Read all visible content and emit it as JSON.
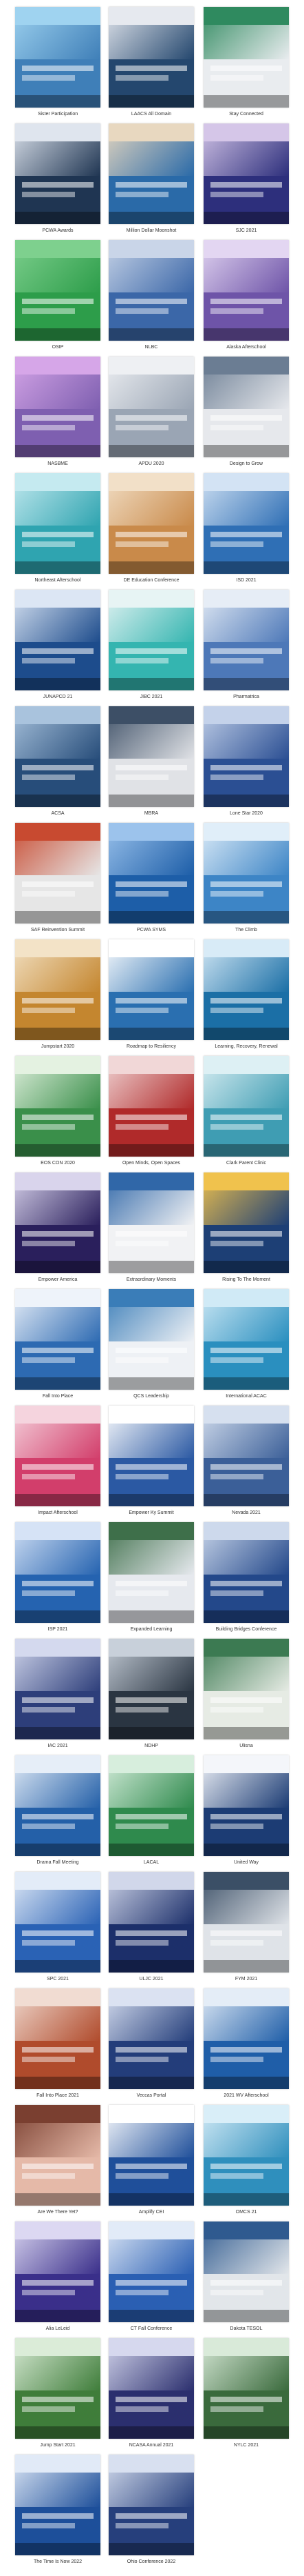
{
  "gallery": {
    "items": [
      {
        "label": "Sister Participation",
        "color": "#3f7fb8",
        "accent": "#9fd3f0"
      },
      {
        "label": "LAACS All Domain",
        "color": "#24476e",
        "accent": "#e6e9ef"
      },
      {
        "label": "Stay Connected",
        "color": "#e9ecef",
        "accent": "#2f8a5f"
      },
      {
        "label": "PCWA Awards",
        "color": "#1f3552",
        "accent": "#dfe5ee"
      },
      {
        "label": "Million Dollar Moonshot",
        "color": "#2a6aa8",
        "accent": "#e8d8c0"
      },
      {
        "label": "SJC 2021",
        "color": "#2d2f7c",
        "accent": "#d5c6e8"
      },
      {
        "label": "OSIP",
        "color": "#2d9d4a",
        "accent": "#7ed08e"
      },
      {
        "label": "NLBC",
        "color": "#3b67a8",
        "accent": "#c9d5e8"
      },
      {
        "label": "Alaska Afterschool",
        "color": "#6e54a8",
        "accent": "#e3d6f2"
      },
      {
        "label": "NASBME",
        "color": "#7e5fb0",
        "accent": "#d6a6e8"
      },
      {
        "label": "APDU 2020",
        "color": "#9aa5b4",
        "accent": "#eef0f3"
      },
      {
        "label": "Design to Grow",
        "color": "#e6e8ec",
        "accent": "#6b7d93"
      },
      {
        "label": "Northeast Afterschool",
        "color": "#2fa4b0",
        "accent": "#c5eaf0"
      },
      {
        "label": "DE Education Conference",
        "color": "#c98a4a",
        "accent": "#f2e0c8"
      },
      {
        "label": "ISD 2021",
        "color": "#2f6fb5",
        "accent": "#d3e3f4"
      },
      {
        "label": "JUNAPCD 21",
        "color": "#1d4c8c",
        "accent": "#dce6f4"
      },
      {
        "label": "JIBC 2021",
        "color": "#34b5b0",
        "accent": "#e7f4f4"
      },
      {
        "label": "Pharmatrica",
        "color": "#4d78b8",
        "accent": "#e6edf6"
      },
      {
        "label": "ACSA",
        "color": "#274d7a",
        "accent": "#a9c3dd"
      },
      {
        "label": "MBRA",
        "color": "#e0e2e6",
        "accent": "#3d4f66"
      },
      {
        "label": "Lone Star 2020",
        "color": "#2b4f93",
        "accent": "#c4d2ea"
      },
      {
        "label": "SAF Reinvention Summit",
        "color": "#e6e6e6",
        "accent": "#c84a30"
      },
      {
        "label": "PCWA SYMS",
        "color": "#1d5ea8",
        "accent": "#9cc3ec"
      },
      {
        "label": "The Climb",
        "color": "#3d85c6",
        "accent": "#e0eef9"
      },
      {
        "label": "Jumpstart 2020",
        "color": "#c4862f",
        "accent": "#f3e3c7"
      },
      {
        "label": "Roadmap to Resiliency",
        "color": "#2a6fb0",
        "accent": "#ffffff"
      },
      {
        "label": "Learning, Recovery, Renewal",
        "color": "#1b6fa6",
        "accent": "#d8ebf7"
      },
      {
        "label": "EOS CON 2020",
        "color": "#3a8f4a",
        "accent": "#e4f2e1"
      },
      {
        "label": "Open Minds, Open Spaces",
        "color": "#b02a2a",
        "accent": "#f1d7d7"
      },
      {
        "label": "Clark Parent Clinic",
        "color": "#3f9db3",
        "accent": "#ddf0f4"
      },
      {
        "label": "Empower America",
        "color": "#2a1f5c",
        "accent": "#d9d4ec"
      },
      {
        "label": "Extraordinary Moments",
        "color": "#f1f2f4",
        "accent": "#3067a8"
      },
      {
        "label": "Rising To The Moment",
        "color": "#1d3f75",
        "accent": "#f0c24d"
      },
      {
        "label": "Fall Into Place",
        "color": "#2d6ab2",
        "accent": "#eef3fa"
      },
      {
        "label": "QCS Leadership",
        "color": "#eef1f5",
        "accent": "#3a7db8"
      },
      {
        "label": "International ACAC",
        "color": "#2a8fbf",
        "accent": "#d0eaf6"
      },
      {
        "label": "Impact Afterschool",
        "color": "#d23e6b",
        "accent": "#f5d4de"
      },
      {
        "label": "Empower Ky Summit",
        "color": "#2b59a3",
        "accent": "#ffffff"
      },
      {
        "label": "Nevada 2021",
        "color": "#3b5f98",
        "accent": "#d6e0ef"
      },
      {
        "label": "ISP 2021",
        "color": "#2563b0",
        "accent": "#d6e3f6"
      },
      {
        "label": "Expanded Learning",
        "color": "#e6e9ee",
        "accent": "#3e6f4a"
      },
      {
        "label": "Building Bridges Conference",
        "color": "#23488a",
        "accent": "#cdd9ec"
      },
      {
        "label": "IAC 2021",
        "color": "#2d3e7a",
        "accent": "#d4d9ee"
      },
      {
        "label": "NDHP",
        "color": "#2a3542",
        "accent": "#c8d0da"
      },
      {
        "label": "Ulisna",
        "color": "#e6ebe4",
        "accent": "#3c7a52"
      },
      {
        "label": "Drama Fall Meeting",
        "color": "#2460a8",
        "accent": "#e6eef8"
      },
      {
        "label": "LACAL",
        "color": "#2f8a4d",
        "accent": "#d7eedd"
      },
      {
        "label": "United Way",
        "color": "#1c3c74",
        "accent": "#f4f6fa"
      },
      {
        "label": "SPC 2021",
        "color": "#2a62b5",
        "accent": "#e3ecf8"
      },
      {
        "label": "ULJC 2021",
        "color": "#1c2f6a",
        "accent": "#d1d7ea"
      },
      {
        "label": "FYM 2021",
        "color": "#dfe3e8",
        "accent": "#3b4f66"
      },
      {
        "label": "Fall Into Place 2021",
        "color": "#b04b2c",
        "accent": "#f1dcd2"
      },
      {
        "label": "Veccas Portal",
        "color": "#233d7a",
        "accent": "#dbe2f2"
      },
      {
        "label": "2021 WV Afterschool",
        "color": "#1f5ea8",
        "accent": "#e4edf7"
      },
      {
        "label": "Are We There Yet?",
        "color": "#e5b9a8",
        "accent": "#7a3f30"
      },
      {
        "label": "Amplify CEI",
        "color": "#1f4f9a",
        "accent": "#ffffff"
      },
      {
        "label": "OMCS 21",
        "color": "#2f8fbd",
        "accent": "#d9eef8"
      },
      {
        "label": "Alia LeLeid",
        "color": "#3a2f8a",
        "accent": "#dcd8f2"
      },
      {
        "label": "CT Fall Conference",
        "color": "#2a5fb3",
        "accent": "#e2ebf8"
      },
      {
        "label": "Dakota TESOL",
        "color": "#e2e6ea",
        "accent": "#2f5a8f"
      },
      {
        "label": "Jump Start 2021",
        "color": "#3f7d3a",
        "accent": "#dbecd8"
      },
      {
        "label": "NCASA Annual 2021",
        "color": "#2b2f6e",
        "accent": "#d6d8ee"
      },
      {
        "label": "NYLC 2021",
        "color": "#3a6a3c",
        "accent": "#d9ead9"
      },
      {
        "label": "The Time Is Now 2022",
        "color": "#1d4f9a",
        "accent": "#e1eaf7"
      },
      {
        "label": "Ohio Conference 2022",
        "color": "#263f7c",
        "accent": "#d8e0f0"
      }
    ]
  }
}
